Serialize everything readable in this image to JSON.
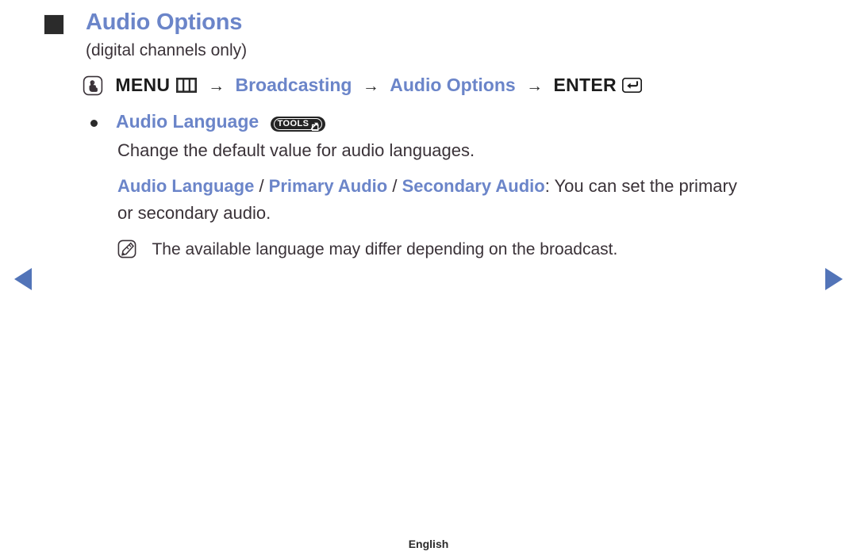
{
  "colors": {
    "accent_blue": "#6b85c9",
    "arrow_blue": "#5274b8",
    "text_dark": "#3a3238",
    "badge_dark": "#242424"
  },
  "section": {
    "bullet_icon": "filled-square-bullet",
    "title": "Audio Options",
    "subtitle": "(digital channels only)"
  },
  "menu_path": {
    "hand_icon": "press-hand-icon",
    "menu_label": "MENU",
    "menu_icon": "menu-grid-icon",
    "arrow1": "→",
    "step1": "Broadcasting",
    "arrow2": "→",
    "step2": "Audio Options",
    "arrow3": "→",
    "enter_label": "ENTER",
    "enter_icon": "enter-return-icon"
  },
  "item": {
    "bullet_icon": "round-dot-bullet",
    "label": "Audio Language",
    "badge": {
      "text": "TOOLS",
      "icon": "tools-arrow-icon"
    },
    "description": "Change the default value for audio languages.",
    "options_para": {
      "term1": "Audio Language",
      "sep1": " / ",
      "term2": "Primary Audio",
      "sep2": " / ",
      "term3": "Secondary Audio",
      "tail": ": You can set the primary or secondary audio."
    },
    "note": {
      "icon": "note-pencil-icon",
      "text": "The available language may differ depending on the broadcast."
    }
  },
  "nav": {
    "prev_icon": "triangle-left-icon",
    "next_icon": "triangle-right-icon"
  },
  "footer": {
    "language": "English"
  }
}
